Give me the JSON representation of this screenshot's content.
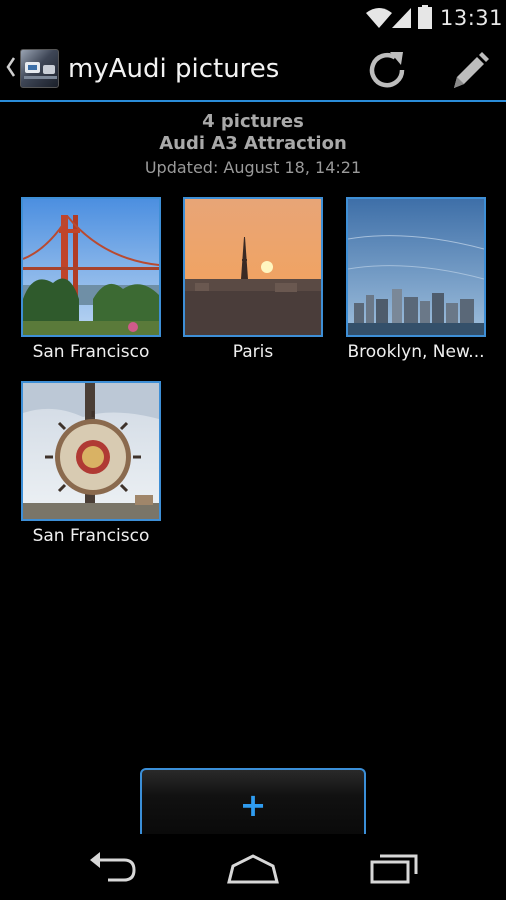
{
  "status_bar": {
    "time": "13:31"
  },
  "action_bar": {
    "title": "myAudi pictures"
  },
  "info": {
    "count": "4 pictures",
    "car": "Audi A3 Attraction",
    "updated": "Updated: August 18, 14:21"
  },
  "pictures": [
    {
      "caption": "San Francisco"
    },
    {
      "caption": "Paris"
    },
    {
      "caption": "Brooklyn, New..."
    },
    {
      "caption": "San Francisco"
    }
  ],
  "add_button": {
    "label": "+"
  },
  "colors": {
    "accent": "#2a8cd9",
    "frame": "#3e8fd6",
    "background": "#000000"
  },
  "icons": [
    "wifi-icon",
    "signal-icon",
    "battery-icon",
    "up-caret-icon",
    "refresh-icon",
    "pencil-icon",
    "back-icon",
    "home-icon",
    "recents-icon"
  ]
}
